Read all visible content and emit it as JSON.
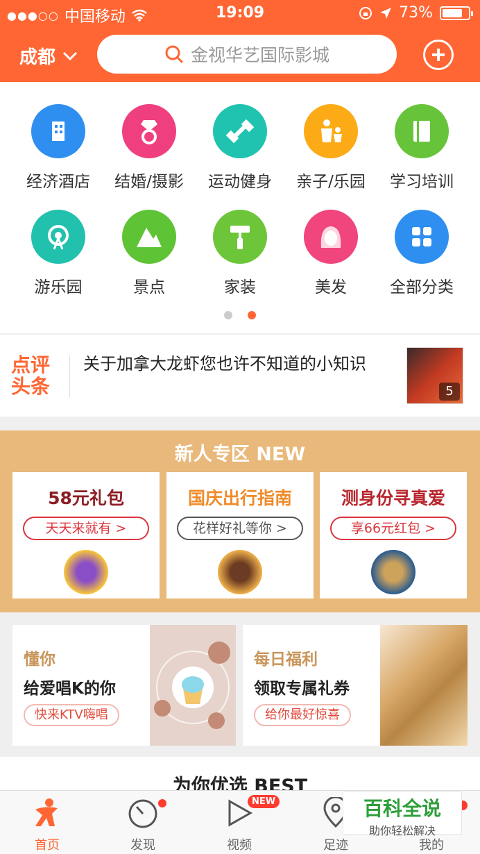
{
  "colors": {
    "brand": "#ff6633",
    "gold": "#e8b97a",
    "red": "#d9363e"
  },
  "status": {
    "carrier": "中国移动",
    "time": "19:09",
    "battery": "73%"
  },
  "header": {
    "city": "成都",
    "search_text": "金视华艺国际影城"
  },
  "categories": [
    {
      "label": "经济酒店",
      "icon": "hotel-icon",
      "color": "#2f8ff0"
    },
    {
      "label": "结婚/摄影",
      "icon": "ring-icon",
      "color": "#ef3f7e"
    },
    {
      "label": "运动健身",
      "icon": "dumbbell-icon",
      "color": "#20c3b0"
    },
    {
      "label": "亲子/乐园",
      "icon": "family-icon",
      "color": "#fcaa16"
    },
    {
      "label": "学习培训",
      "icon": "book-icon",
      "color": "#67c43a"
    },
    {
      "label": "游乐园",
      "icon": "ferris-wheel-icon",
      "color": "#21c1ad"
    },
    {
      "label": "景点",
      "icon": "mountain-icon",
      "color": "#5fc336"
    },
    {
      "label": "家装",
      "icon": "paint-roller-icon",
      "color": "#6dc53a"
    },
    {
      "label": "美发",
      "icon": "hair-icon",
      "color": "#f0457d"
    },
    {
      "label": "全部分类",
      "icon": "grid-icon",
      "color": "#2f8ff0"
    }
  ],
  "news": {
    "logo": "点评头条",
    "headline": "关于加拿大龙虾您也许不知道的小知识",
    "image_count": "5"
  },
  "new_user": {
    "title": "新人专区 NEW",
    "cards": [
      {
        "title": "58元礼包",
        "pill": "天天来就有 >",
        "title_color": "#8b1e24"
      },
      {
        "title": "国庆出行指南",
        "pill": "花样好礼等你 >",
        "title_color": "#f08b2a"
      },
      {
        "title": "测身份寻真爱",
        "pill": "享66元红包 >",
        "title_color": "#b8262d"
      }
    ]
  },
  "promos": [
    {
      "t1": "懂你",
      "t2": "给爱唱K的你",
      "pill": "快来KTV嗨唱"
    },
    {
      "t1": "每日福利",
      "t2": "领取专属礼券",
      "pill": "给你最好惊喜"
    }
  ],
  "best": {
    "title": "为你优选 BEST"
  },
  "tabs": [
    {
      "label": "首页",
      "icon": "home-person-icon",
      "active": true
    },
    {
      "label": "发现",
      "icon": "discover-icon"
    },
    {
      "label": "视频",
      "icon": "play-icon",
      "badge": "NEW"
    },
    {
      "label": "足迹",
      "icon": "location-icon"
    },
    {
      "label": "我的",
      "icon": "profile-icon"
    }
  ],
  "watermark": {
    "line1": "百科全说",
    "line2": "助你轻松解决"
  }
}
